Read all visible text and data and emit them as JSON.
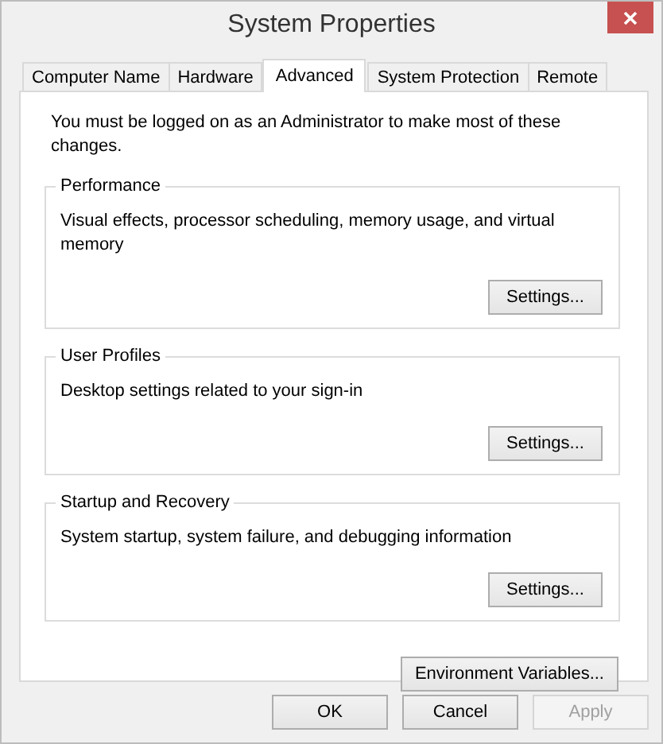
{
  "window": {
    "title": "System Properties"
  },
  "tabs": [
    {
      "label": "Computer Name",
      "selected": false
    },
    {
      "label": "Hardware",
      "selected": false
    },
    {
      "label": "Advanced",
      "selected": true
    },
    {
      "label": "System Protection",
      "selected": false
    },
    {
      "label": "Remote",
      "selected": false
    }
  ],
  "notice": "You must be logged on as an Administrator to make most of these changes.",
  "groups": [
    {
      "title": "Performance",
      "description": "Visual effects, processor scheduling, memory usage, and virtual memory",
      "button": "Settings..."
    },
    {
      "title": "User Profiles",
      "description": "Desktop settings related to your sign-in",
      "button": "Settings..."
    },
    {
      "title": "Startup and Recovery",
      "description": "System startup, system failure, and debugging information",
      "button": "Settings..."
    }
  ],
  "environment_button": "Environment Variables...",
  "buttons": [
    {
      "label": "OK",
      "disabled": false
    },
    {
      "label": "Cancel",
      "disabled": false
    },
    {
      "label": "Apply",
      "disabled": true
    }
  ]
}
